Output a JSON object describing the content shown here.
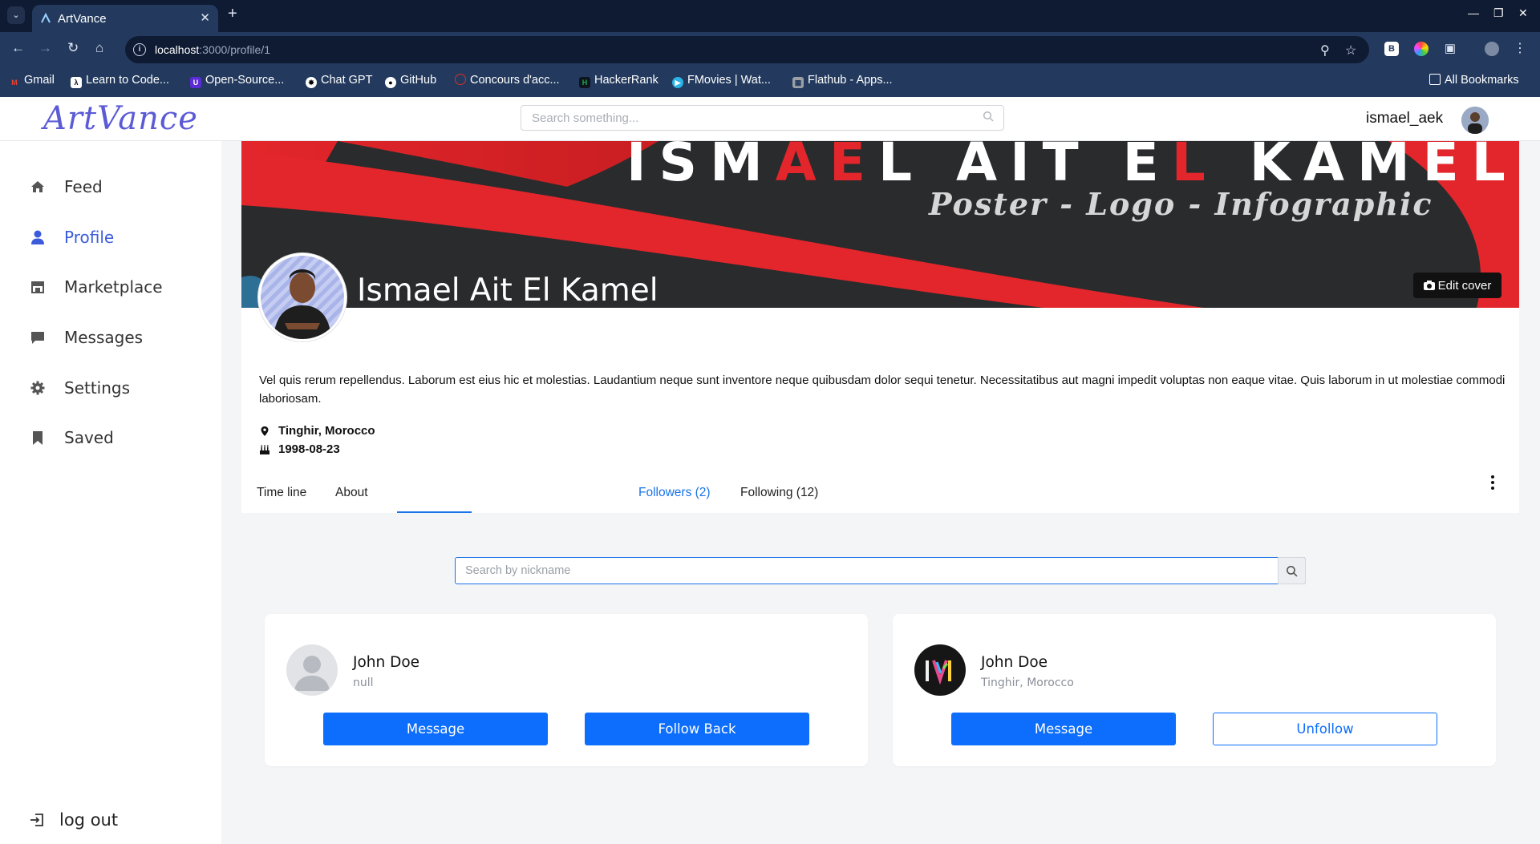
{
  "browser": {
    "tab_title": "ArtVance",
    "url_host": "localhost",
    "url_rest": ":3000/profile/1",
    "bookmarks": [
      {
        "label": "Gmail",
        "color": "#ea4335"
      },
      {
        "label": "Learn to Code...",
        "color": "#0a0a23"
      },
      {
        "label": "Open-Source...",
        "color": "#5b2bd6"
      },
      {
        "label": "Chat GPT",
        "color": "#10a37f"
      },
      {
        "label": "GitHub",
        "color": "#ffffff"
      },
      {
        "label": "Concours d'acc...",
        "color": "#d93025"
      },
      {
        "label": "HackerRank",
        "color": "#1ba94c"
      },
      {
        "label": "FMovies | Wat...",
        "color": "#2bb3e6"
      },
      {
        "label": "Flathub - Apps...",
        "color": "#9aa0a6"
      }
    ],
    "all_bookmarks": "All Bookmarks"
  },
  "header": {
    "logo": "ArtVance",
    "search_placeholder": "Search something...",
    "username": "ismael_aek"
  },
  "sidebar": {
    "items": [
      {
        "label": "Feed",
        "icon": "home-icon"
      },
      {
        "label": "Profile",
        "icon": "user-icon",
        "active": true
      },
      {
        "label": "Marketplace",
        "icon": "store-icon"
      },
      {
        "label": "Messages",
        "icon": "message-icon"
      },
      {
        "label": "Settings",
        "icon": "gear-icon"
      },
      {
        "label": "Saved",
        "icon": "bookmark-icon"
      }
    ],
    "logout": "log out"
  },
  "cover": {
    "deco_before": "ISM",
    "deco_red1": "AE",
    "deco_mid": "L AIT E",
    "deco_red2": "L",
    "deco_after": " KAMEL",
    "subtitle": "Poster - Logo - Infographic",
    "edit_label": "Edit cover"
  },
  "profile": {
    "name": "Ismael Ait El Kamel",
    "bio": "Vel quis rerum repellendus. Laborum est eius hic et molestias. Laudantium neque sunt inventore neque quibusdam dolor sequi tenetur. Necessitatibus aut magni impedit voluptas non eaque vitae. Quis laborum in ut molestiae commodi laboriosam.",
    "location": "Tinghir, Morocco",
    "birthday": "1998-08-23"
  },
  "tabs": [
    {
      "label": "Time line"
    },
    {
      "label": "About"
    },
    {
      "label": "Followers (2)",
      "active": true
    },
    {
      "label": "Following (12)"
    }
  ],
  "followers_search_placeholder": "Search by nickname",
  "followers": [
    {
      "name": "John Doe",
      "location": "null",
      "avatar": "default-avatar",
      "primary_action": "Message",
      "secondary_action": "Follow Back",
      "secondary_style": "primary"
    },
    {
      "name": "John Doe",
      "location": "Tinghir, Morocco",
      "avatar": "monogram-avatar",
      "primary_action": "Message",
      "secondary_action": "Unfollow",
      "secondary_style": "outline"
    }
  ],
  "colors": {
    "accent": "#3b5bdb",
    "tab_active": "#1a73e8",
    "button_primary": "#0d6efd",
    "cover_red": "#e3262b",
    "cover_dark": "#2a2b2d"
  }
}
